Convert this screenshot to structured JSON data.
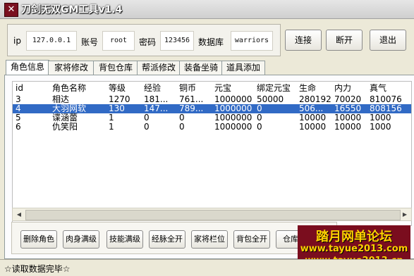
{
  "window": {
    "title": "刀剑无双GM工具v1.4"
  },
  "connection": {
    "ip_label": "ip",
    "ip_value": "127.0.0.1",
    "account_label": "账号",
    "account_value": "root",
    "password_label": "密码",
    "password_value": "123456",
    "db_label": "数据库",
    "db_value": "warriors"
  },
  "buttons": {
    "connect": "连接",
    "disconnect": "断开",
    "exit": "退出"
  },
  "tabs": [
    "角色信息",
    "家将修改",
    "背包仓库",
    "帮派修改",
    "装备坐骑",
    "道具添加"
  ],
  "table": {
    "headers": [
      "id",
      "角色名称",
      "等级",
      "经验",
      "铜币",
      "元宝",
      "绑定元宝",
      "生命",
      "内力",
      "真气"
    ],
    "rows": [
      [
        "3",
        "相达",
        "1270",
        "181...",
        "761...",
        "1000000",
        "50000",
        "280192",
        "70020",
        "810076"
      ],
      [
        "4",
        "大羽网软",
        "130",
        "147...",
        "789...",
        "1000000",
        "0",
        "506...",
        "16550",
        "808156"
      ],
      [
        "5",
        "谍涵蕾",
        "1",
        "0",
        "0",
        "1000000",
        "0",
        "10000",
        "10000",
        "1000"
      ],
      [
        "6",
        "仇笑阳",
        "1",
        "0",
        "0",
        "1000000",
        "0",
        "10000",
        "10000",
        "1000"
      ]
    ],
    "selected_row": 1
  },
  "actions": [
    "删除角色",
    "肉身满级",
    "技能满级",
    "经脉全开",
    "家将栏位",
    "背包全开",
    "仓库"
  ],
  "watermark": {
    "title": "踏月网单论坛",
    "url1": "www.tayue2013.com",
    "url2": "www.tayue2013.cn"
  },
  "status": {
    "text": "☆读取数据完毕☆"
  },
  "colors": {
    "selection": "#316ac5",
    "watermark_bg": "#7a0d1e",
    "watermark_text": "#ffd100"
  }
}
